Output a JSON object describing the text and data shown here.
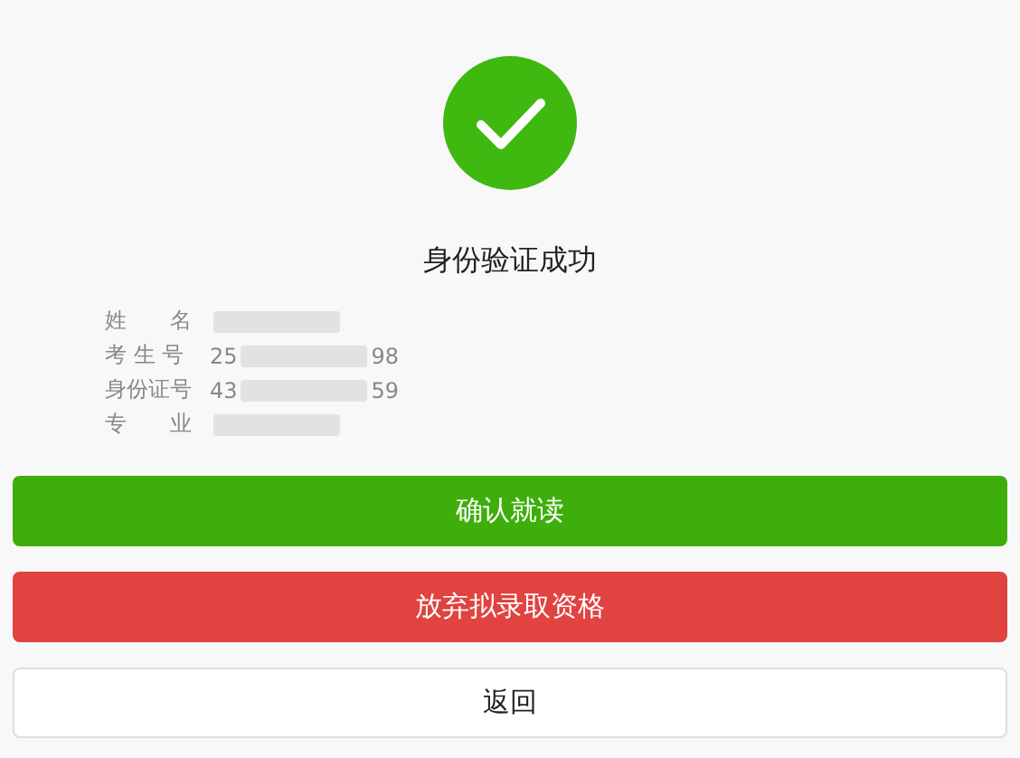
{
  "result": {
    "title": "身份验证成功"
  },
  "info": [
    {
      "label": "姓　　名"
    },
    {
      "label": "考 生 号",
      "value_start": "25",
      "value_end": "98"
    },
    {
      "label": "身份证号",
      "value_start": "43",
      "value_end": "59"
    },
    {
      "label": "专　　业"
    }
  ],
  "buttons": [
    {
      "label": "确认就读",
      "kind": "primary"
    },
    {
      "label": "放弃拟录取资格",
      "kind": "danger"
    },
    {
      "label": "返回",
      "kind": "default"
    }
  ]
}
